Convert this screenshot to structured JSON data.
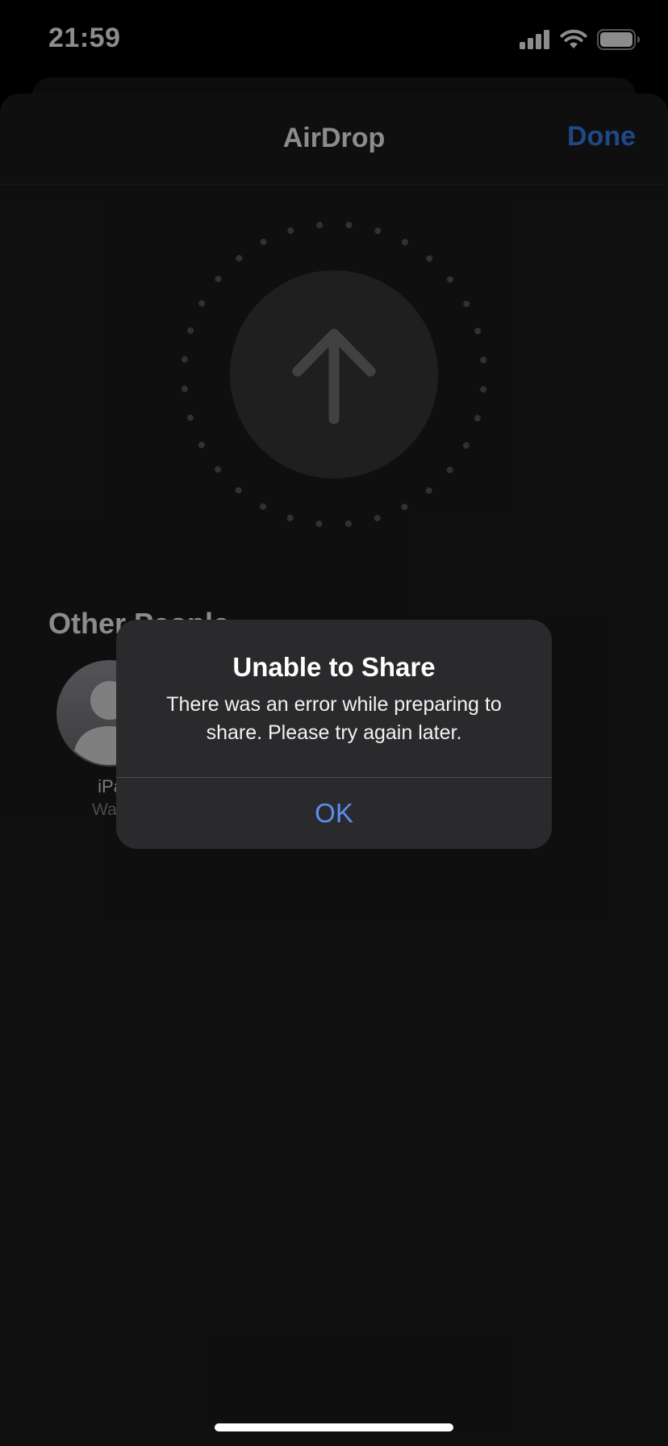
{
  "status_bar": {
    "time": "21:59",
    "icons": [
      "cellular-signal-icon",
      "wifi-icon",
      "battery-icon"
    ]
  },
  "sheet": {
    "title": "AirDrop",
    "done_label": "Done",
    "radar_icon": "arrow-up-icon",
    "section_title": "Other People",
    "people": [
      {
        "name": "iPa",
        "status": "Waiti",
        "icon": "person-silhouette-icon"
      }
    ]
  },
  "alert": {
    "title": "Unable to Share",
    "message": "There was an error while preparing to share. Please try again later.",
    "ok_label": "OK"
  },
  "colors": {
    "accent": "#3b82f6",
    "alert_button": "#5c8df0",
    "sheet_background": "#1d1d1d",
    "alert_background": "#2a2a2c"
  }
}
